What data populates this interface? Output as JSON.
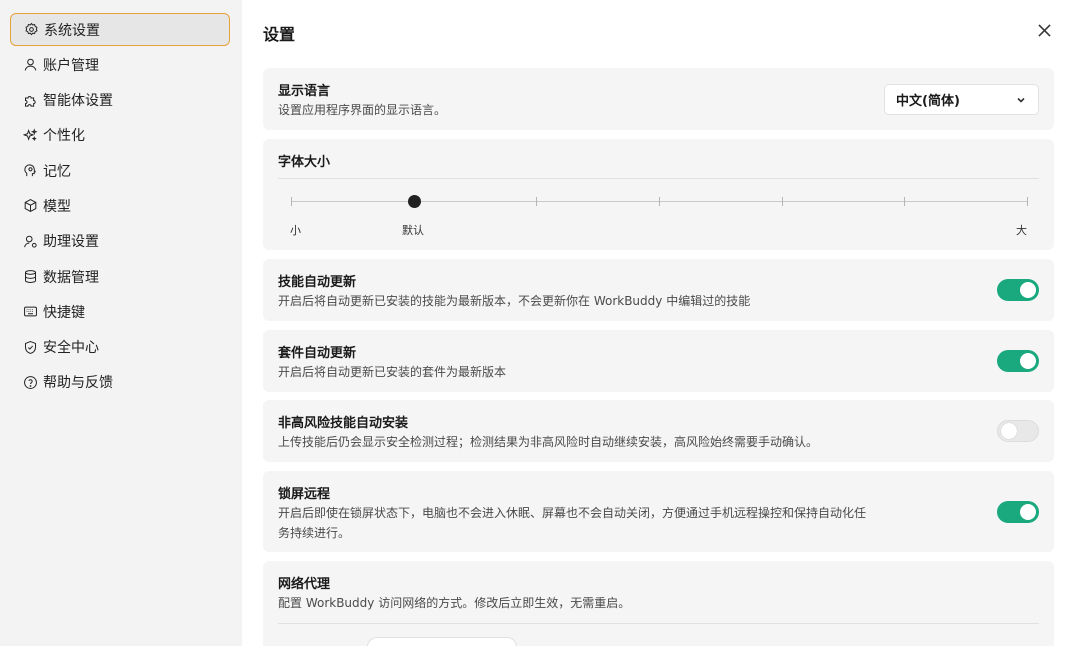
{
  "sidebar": {
    "items": [
      {
        "label": "系统设置",
        "icon": "gear-icon",
        "active": true
      },
      {
        "label": "账户管理",
        "icon": "user-icon"
      },
      {
        "label": "智能体设置",
        "icon": "puzzle-icon"
      },
      {
        "label": "个性化",
        "icon": "sparkle-icon"
      },
      {
        "label": "记忆",
        "icon": "head-icon"
      },
      {
        "label": "模型",
        "icon": "cube-icon"
      },
      {
        "label": "助理设置",
        "icon": "user-cog-icon"
      },
      {
        "label": "数据管理",
        "icon": "database-icon"
      },
      {
        "label": "快捷键",
        "icon": "keyboard-icon"
      },
      {
        "label": "安全中心",
        "icon": "shield-icon"
      },
      {
        "label": "帮助与反馈",
        "icon": "help-icon"
      }
    ],
    "active_border_color": "#e7a23a"
  },
  "main": {
    "title": "设置",
    "language": {
      "title": "显示语言",
      "desc": "设置应用程序界面的显示语言。",
      "selected": "中文(简体)"
    },
    "font_size": {
      "title": "字体大小",
      "min_label": "小",
      "default_label": "默认",
      "max_label": "大",
      "steps": 7,
      "selected_step": 1
    },
    "skill_update": {
      "title": "技能自动更新",
      "desc": "开启后将自动更新已安装的技能为最新版本，不会更新你在 WorkBuddy 中编辑过的技能",
      "enabled": true
    },
    "kit_update": {
      "title": "套件自动更新",
      "desc": "开启后将自动更新已安装的套件为最新版本",
      "enabled": true
    },
    "low_risk_install": {
      "title": "非高风险技能自动安装",
      "desc": "上传技能后仍会显示安全检测过程；检测结果为非高风险时自动继续安装，高风险始终需要手动确认。",
      "enabled": false
    },
    "lock_remote": {
      "title": "锁屏远程",
      "desc_line1": "开启后即使在锁屏状态下，电脑也不会进入休眠、屏幕也不会自动关闭，方便通过手机远程操控和保持自动化任",
      "desc_line2": "务持续进行。",
      "enabled": true
    },
    "proxy": {
      "title": "网络代理",
      "desc": "配置 WorkBuddy 访问网络的方式。修改后立即生效，无需重启。"
    },
    "accent_color": "#1aa87e"
  }
}
